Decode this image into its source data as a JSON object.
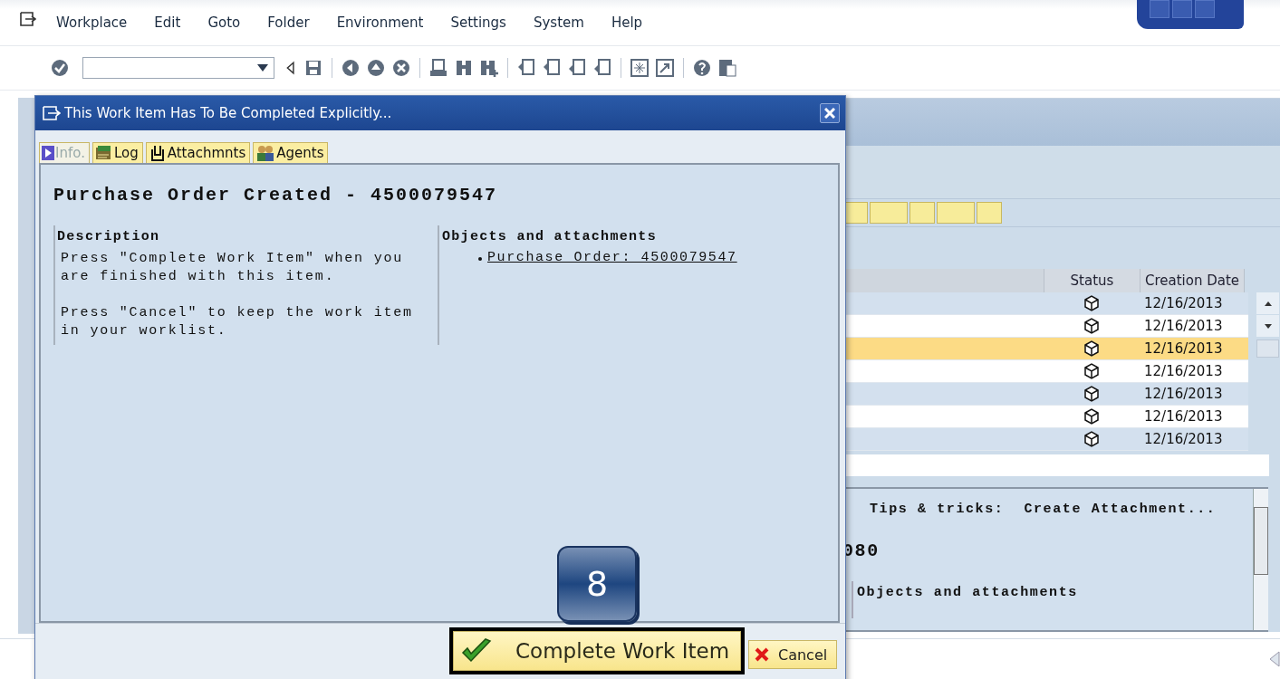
{
  "menu_bar": {
    "items": [
      "Workplace",
      "Edit",
      "Goto",
      "Folder",
      "Environment",
      "Settings",
      "System",
      "Help"
    ]
  },
  "grid": {
    "columns": [
      "Status",
      "Creation Date"
    ],
    "rows": [
      {
        "date": "12/16/2013",
        "selected": false
      },
      {
        "date": "12/16/2013",
        "selected": false
      },
      {
        "date": "12/16/2013",
        "selected": true
      },
      {
        "date": "12/16/2013",
        "selected": false
      },
      {
        "date": "12/16/2013",
        "selected": false
      },
      {
        "date": "12/16/2013",
        "selected": false
      },
      {
        "date": "12/16/2013",
        "selected": false
      }
    ]
  },
  "preview": {
    "tips_label": "Tips & tricks:",
    "tips_link": "Create Attachment...",
    "number_fragment": "080",
    "objects_heading": "Objects and attachments"
  },
  "dialog": {
    "title": "This Work Item Has To Be Completed Explicitly...",
    "tabs": [
      {
        "label": "Info.",
        "kind": "info",
        "selected": true
      },
      {
        "label": "Log",
        "kind": "log",
        "selected": false
      },
      {
        "label": "Attachmnts",
        "kind": "attachments",
        "selected": false
      },
      {
        "label": "Agents",
        "kind": "agents",
        "selected": false
      }
    ],
    "heading": "Purchase Order Created - 4500079547",
    "description": {
      "title": "Description",
      "paragraphs": [
        "Press \"Complete Work Item\" when you are finished with this item.",
        "Press \"Cancel\" to keep the work item in your worklist."
      ]
    },
    "objects": {
      "title": "Objects and attachments",
      "items": [
        "Purchase Order: 4500079547"
      ]
    },
    "buttons": [
      {
        "label": "Complete Work Item",
        "kind": "complete"
      },
      {
        "label": "Cancel",
        "kind": "cancel"
      }
    ]
  },
  "callout": {
    "label": "8"
  }
}
